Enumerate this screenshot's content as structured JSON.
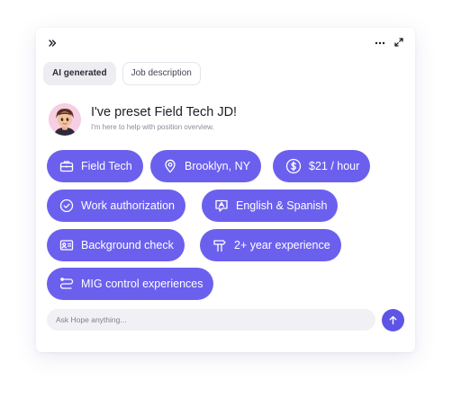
{
  "toolbar": {
    "collapse_icon": "double-chevron-right-icon",
    "more_icon": "more-horizontal-icon",
    "expand_icon": "expand-icon"
  },
  "tabs": [
    {
      "label": "AI generated",
      "active": true
    },
    {
      "label": "Job description",
      "active": false
    }
  ],
  "greeting": {
    "title": "I've preset Field Tech JD!",
    "subtitle": "I'm here to help with position overview."
  },
  "chips": [
    {
      "label": "Field Tech",
      "icon": "briefcase-icon"
    },
    {
      "label": "Brooklyn, NY",
      "icon": "map-pin-icon"
    },
    {
      "label": "$21 / hour",
      "icon": "dollar-circle-icon"
    },
    {
      "label": "Work authorization",
      "icon": "check-circle-icon"
    },
    {
      "label": "English & Spanish",
      "icon": "translate-icon"
    },
    {
      "label": "Background check",
      "icon": "id-card-icon"
    },
    {
      "label": "2+ year experience",
      "icon": "signpost-icon"
    },
    {
      "label": "MIG control experiences",
      "icon": "route-icon"
    }
  ],
  "input": {
    "placeholder": "Ask Hope anything...",
    "value": ""
  },
  "send": {
    "icon": "arrow-up-icon"
  },
  "colors": {
    "chip_bg": "#6b60ee",
    "send_bg": "#5e55e6",
    "avatar_bg": "#f6cfe4"
  }
}
